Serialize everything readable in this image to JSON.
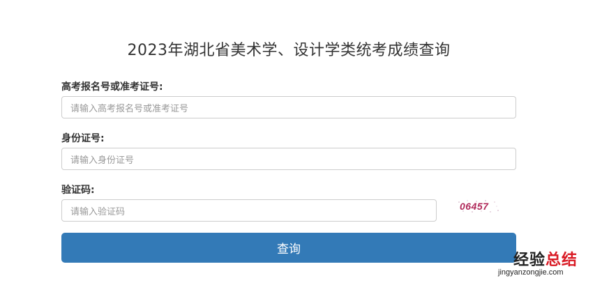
{
  "page": {
    "title": "2023年湖北省美术学、设计学类统考成绩查询"
  },
  "form": {
    "exam_number": {
      "label": "高考报名号或准考证号:",
      "placeholder": "请输入高考报名号或准考证号"
    },
    "id_number": {
      "label": "身份证号:",
      "placeholder": "请输入身份证号"
    },
    "captcha": {
      "label": "验证码:",
      "placeholder": "请输入验证码",
      "image_text": "06457"
    },
    "submit_label": "查询"
  },
  "watermark": {
    "brand_part1": "经验",
    "brand_part2": "总结",
    "url": "jingyanzongjie.com"
  },
  "colors": {
    "primary_button": "#337ab7",
    "captcha_text": "#b0295a",
    "watermark_red": "#d91a24"
  }
}
